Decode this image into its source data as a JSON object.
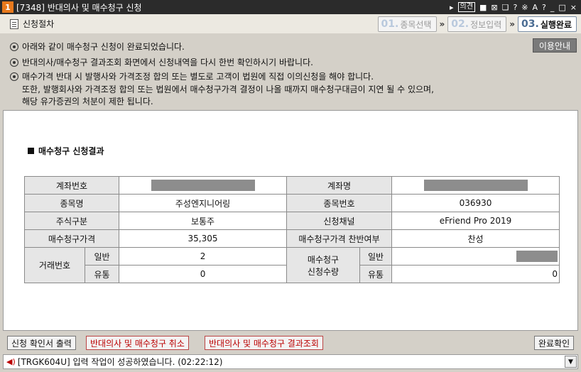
{
  "window": {
    "number": "1",
    "title": "[7348] 반대의사 및 매수청구 신청",
    "tools": [
      "▸",
      "의견",
      "■",
      "⊠",
      "❏",
      "?",
      "※",
      "A",
      "?",
      "_",
      "□",
      "×"
    ]
  },
  "header": {
    "label": "신청절차",
    "steps": [
      {
        "num": "01.",
        "text": "종목선택",
        "active": false
      },
      {
        "num": "02.",
        "text": "정보입력",
        "active": false
      },
      {
        "num": "03.",
        "text": "실행완료",
        "active": true
      }
    ],
    "arrow": "»"
  },
  "notice": {
    "lines": [
      "아래와 같이 매수청구 신청이 완료되었습니다.",
      "반대의사/매수청구 결과조회 화면에서 신청내역을 다시 한번 확인하시기 바랍니다.",
      "매수가격 반대 시 발행사와 가격조정 합의 또는 별도로 고객이 법원에 직접 이의신청을 해야 합니다.",
      "또한, 발행회사와 가격조정 합의 또는 법원에서 매수청구가격 결정이 나올 때까지 매수청구대금이 지연 될 수 있으며,",
      "해당 유가증권의 처분이 제한 됩니다."
    ],
    "guide_button": "이용안내"
  },
  "section_title": "매수청구 신청결과",
  "table": {
    "account_no_label": "계좌번호",
    "account_name_label": "계좌명",
    "stock_name_label": "종목명",
    "stock_name": "주성엔지니어링",
    "stock_code_label": "종목번호",
    "stock_code": "036930",
    "share_type_label": "주식구분",
    "share_type": "보통주",
    "channel_label": "신청채널",
    "channel": "eFriend Pro 2019",
    "price_label": "매수청구가격",
    "price": "35,305",
    "approval_label": "매수청구가격 찬반여부",
    "approval": "찬성",
    "trade_no_label": "거래번호",
    "general_label": "일반",
    "circulation_label": "유통",
    "trade_general": "2",
    "trade_circulation": "0",
    "qty_label_1": "매수청구",
    "qty_label_2": "신청수량",
    "qty_circulation": "0"
  },
  "buttons": {
    "print": "신청 확인서 출력",
    "cancel": "반대의사 및 매수청구 취소",
    "inquiry": "반대의사 및 매수청구 결과조회",
    "confirm": "완료확인"
  },
  "status": {
    "message": "[TRGK604U] 입력 작업이 성공하였습니다. (02:22:12)"
  },
  "colors": {
    "titlebar": "#2b2b2b",
    "step_active": "#4a6c93",
    "cancel_text": "#b00000"
  }
}
